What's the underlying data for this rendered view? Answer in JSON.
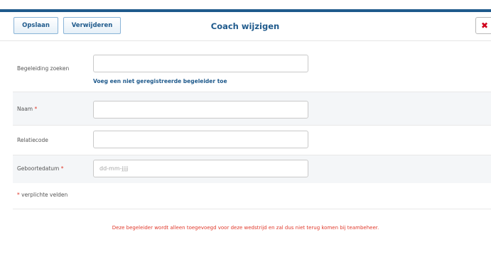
{
  "toolbar": {
    "save_label": "Opslaan",
    "delete_label": "Verwijderen",
    "title": "Coach wijzigen",
    "close_glyph": "✖"
  },
  "form": {
    "search": {
      "label": "Begeleiding zoeken",
      "value": "",
      "link": "Voeg een niet geregistreerde begeleider toe"
    },
    "name": {
      "label": "Naam",
      "required_mark": "*",
      "value": ""
    },
    "relation_code": {
      "label": "Relatiecode",
      "value": ""
    },
    "birthdate": {
      "label": "Geboortedatum",
      "required_mark": "*",
      "placeholder": "dd-mm-jjjj",
      "value": ""
    }
  },
  "footnote": {
    "mark": "*",
    "text": " verplichte velden"
  },
  "warning": "Deze begeleider wordt alleen toegevoegd voor deze wedstrijd en zal dus niet terug komen bij teambeheer.",
  "colors": {
    "accent": "#1f5a8c",
    "required": "#e0392b",
    "close": "#d0021b",
    "alt_row": "#f4f6f8"
  },
  "icons": {
    "close": "close-icon"
  }
}
